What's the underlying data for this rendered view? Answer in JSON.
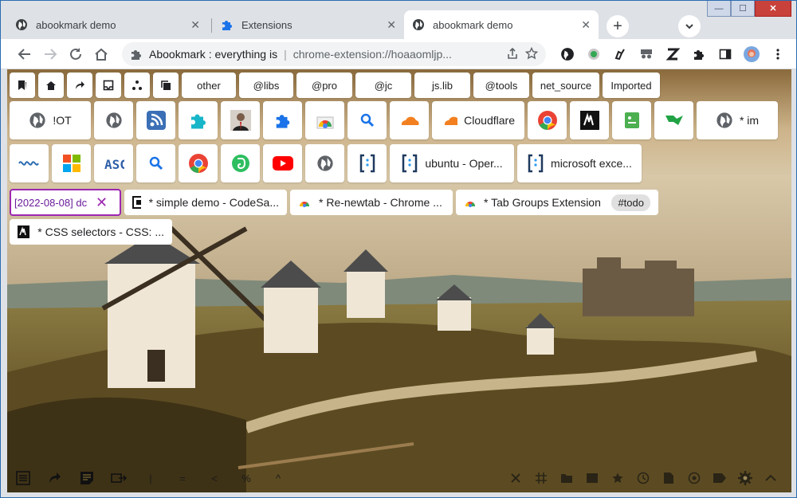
{
  "window": {
    "controls": {
      "minimize": "—",
      "maximize": "☐",
      "close": "✕"
    }
  },
  "tabs": [
    {
      "title": "abookmark demo",
      "icon": "globe-icon",
      "active": false
    },
    {
      "title": "Extensions",
      "icon": "puzzle-icon",
      "active": false
    },
    {
      "title": "abookmark demo",
      "icon": "globe-icon",
      "active": true
    }
  ],
  "tab_close_glyph": "✕",
  "new_tab_glyph": "+",
  "omnibox": {
    "title": "Abookmark : everything is",
    "url": "chrome-extension://hoaaomljp..."
  },
  "bookmark_bar": {
    "labels": [
      "other",
      "@libs",
      "@pro",
      "@jc",
      "js.lib",
      "@tools",
      "net_source",
      "Imported"
    ]
  },
  "tiles_row1": {
    "iot_label": "!OT",
    "cloudflare_label": "Cloudflare",
    "im_label": "* im"
  },
  "tiles_row2": {
    "ubuntu_label": "ubuntu - Oper...",
    "excel_label": "microsoft exce..."
  },
  "open_tabs": {
    "search_value": "[2022-08-08] dc",
    "clear_glyph": "✕",
    "items": [
      "* simple demo - CodeSa...",
      "* Re-newtab - Chrome ...",
      "* Tab Groups Extension ...",
      "* CSS selectors - CSS: ..."
    ],
    "tag": "#todo"
  },
  "bottom_bar": {
    "glyphs": [
      "|",
      "=",
      "<",
      "%",
      "^"
    ]
  },
  "colors": {
    "accent": "#1a73e8",
    "search_border": "#9c27b0",
    "cloudflare": "#f38020",
    "evernote": "#2dbe60",
    "youtube": "#ff0000"
  }
}
